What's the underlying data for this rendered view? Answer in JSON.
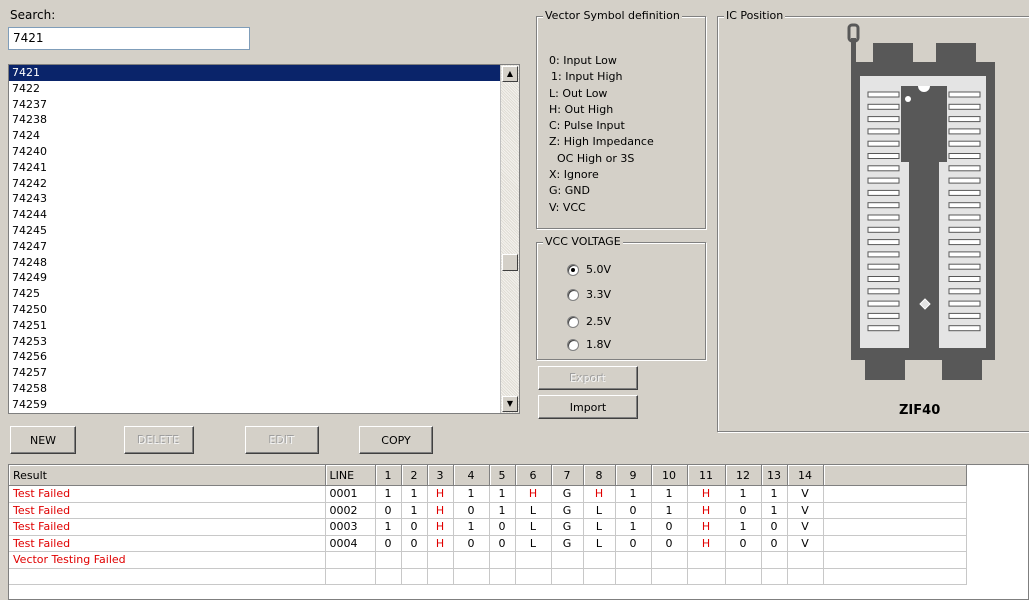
{
  "search": {
    "label": "Search:",
    "value": "7421"
  },
  "ic_list": {
    "selected": "7421",
    "items": [
      "7421",
      "7422",
      "74237",
      "74238",
      "7424",
      "74240",
      "74241",
      "74242",
      "74243",
      "74244",
      "74245",
      "74247",
      "74248",
      "74249",
      "7425",
      "74250",
      "74251",
      "74253",
      "74256",
      "74257",
      "74258",
      "74259"
    ]
  },
  "buttons": {
    "new": "NEW",
    "delete": "DELETE",
    "edit": "EDIT",
    "copy": "COPY",
    "export": "Export",
    "import": "Import"
  },
  "vector_def": {
    "title": "Vector Symbol definition",
    "lines": [
      "0: Input Low",
      "1: Input High",
      "L: Out Low",
      "H: Out High",
      "C: Pulse Input",
      "Z: High Impedance",
      "OC High or 3S",
      "X: Ignore",
      "G: GND",
      "V: VCC"
    ]
  },
  "vcc": {
    "title": "VCC VOLTAGE",
    "options": [
      "5.0V",
      "3.3V",
      "2.5V",
      "1.8V"
    ],
    "selected": "5.0V"
  },
  "ic_position": {
    "title": "IC Position",
    "socket": "ZIF40"
  },
  "results": {
    "columns": [
      "Result",
      "LINE",
      "1",
      "2",
      "3",
      "4",
      "5",
      "6",
      "7",
      "8",
      "9",
      "10",
      "11",
      "12",
      "13",
      "14"
    ],
    "rows": [
      {
        "result": "Test Failed",
        "line": "0001",
        "pins": [
          "1",
          "1",
          "H",
          "1",
          "1",
          "H",
          "G",
          "H",
          "1",
          "1",
          "H",
          "1",
          "1",
          "V"
        ]
      },
      {
        "result": "Test Failed",
        "line": "0002",
        "pins": [
          "0",
          "1",
          "H",
          "0",
          "1",
          "L",
          "G",
          "L",
          "0",
          "1",
          "H",
          "0",
          "1",
          "V"
        ]
      },
      {
        "result": "Test Failed",
        "line": "0003",
        "pins": [
          "1",
          "0",
          "H",
          "1",
          "0",
          "L",
          "G",
          "L",
          "1",
          "0",
          "H",
          "1",
          "0",
          "V"
        ]
      },
      {
        "result": "Test Failed",
        "line": "0004",
        "pins": [
          "0",
          "0",
          "H",
          "0",
          "0",
          "L",
          "G",
          "L",
          "0",
          "0",
          "H",
          "0",
          "0",
          "V"
        ]
      },
      {
        "result": "Vector Testing Failed",
        "line": "",
        "pins": [
          "",
          "",
          "",
          "",
          "",
          "",
          "",
          "",
          "",
          "",
          "",
          "",
          "",
          ""
        ]
      },
      {
        "result": "",
        "line": "",
        "pins": [
          "",
          "",
          "",
          "",
          "",
          "",
          "",
          "",
          "",
          "",
          "",
          "",
          "",
          ""
        ]
      }
    ]
  },
  "colors": {
    "fail": "#e00000",
    "selection": "#0a246a",
    "window": "#d4d0c8"
  }
}
